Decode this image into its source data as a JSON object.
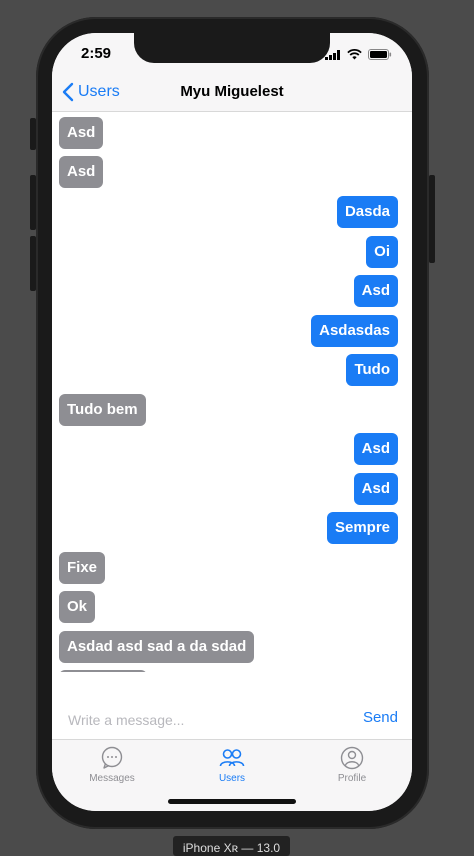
{
  "status_bar": {
    "time": "2:59"
  },
  "nav": {
    "back_label": "Users",
    "title": "Myu Miguelest"
  },
  "messages": [
    {
      "text": "Asd",
      "side": "in"
    },
    {
      "text": "Asd",
      "side": "in"
    },
    {
      "text": "Dasda",
      "side": "out"
    },
    {
      "text": "Oi",
      "side": "out"
    },
    {
      "text": "Asd",
      "side": "out"
    },
    {
      "text": "Asdasdas",
      "side": "out"
    },
    {
      "text": "Tudo",
      "side": "out"
    },
    {
      "text": "Tudo bem",
      "side": "in"
    },
    {
      "text": "Asd",
      "side": "out"
    },
    {
      "text": "Asd",
      "side": "out"
    },
    {
      "text": "Sempre",
      "side": "out"
    },
    {
      "text": "Fixe",
      "side": "in"
    },
    {
      "text": "Ok",
      "side": "in"
    },
    {
      "text": "Asdad asd sad a da sdad",
      "side": "in"
    },
    {
      "text": "",
      "side": "in"
    }
  ],
  "composer": {
    "placeholder": "Write a message...",
    "send_label": "Send"
  },
  "tabs": [
    {
      "label": "Messages",
      "icon": "chat-bubble-icon",
      "active": false
    },
    {
      "label": "Users",
      "icon": "users-icon",
      "active": true
    },
    {
      "label": "Profile",
      "icon": "profile-icon",
      "active": false
    }
  ],
  "device_label": "iPhone Xʀ — 13.0",
  "colors": {
    "accent": "#1a7cf5",
    "incoming": "#8e8e93",
    "bar": "#f7f6f7"
  }
}
